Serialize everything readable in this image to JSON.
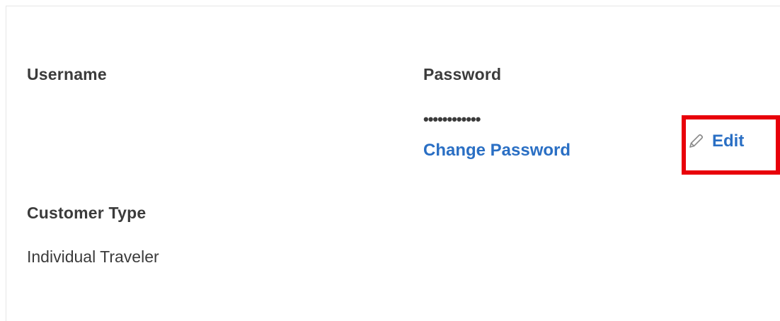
{
  "account": {
    "username_label": "Username",
    "username_value": "",
    "password_label": "Password",
    "password_masked": "••••••••••••",
    "change_password_label": "Change Password",
    "edit_label": "Edit",
    "edit_icon": "pencil-icon",
    "customer_type_label": "Customer Type",
    "customer_type_value": "Individual Traveler"
  },
  "colors": {
    "link": "#2a6fc4",
    "text": "#3b3b3b",
    "highlight": "#e8000a"
  }
}
